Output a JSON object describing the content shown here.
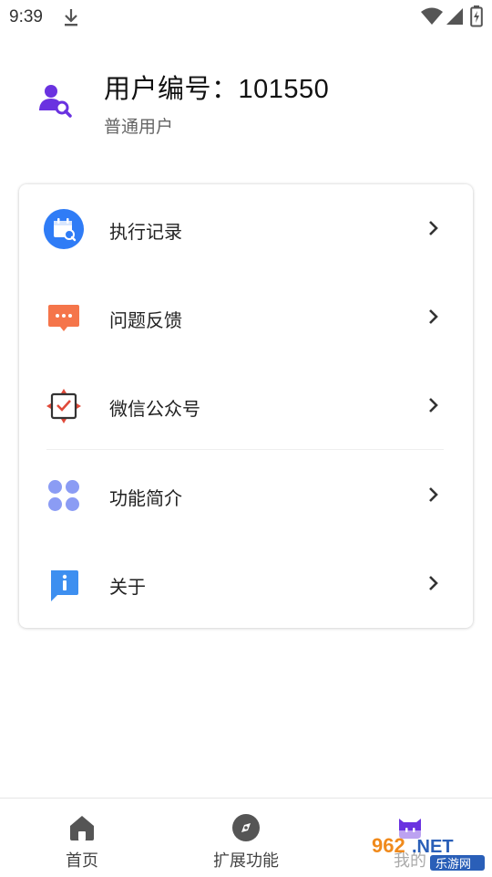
{
  "status_bar": {
    "time": "9:39",
    "icons": [
      "download-icon",
      "wifi-icon",
      "signal-icon",
      "battery-icon"
    ]
  },
  "profile": {
    "user_id": "用户编号：101550",
    "user_type": "普通用户",
    "avatar_icon": "user-search-icon"
  },
  "menu": [
    {
      "label": "执行记录",
      "icon": "calendar-search-icon"
    },
    {
      "label": "问题反馈",
      "icon": "chat-bubble-icon"
    },
    {
      "label": "微信公众号",
      "icon": "wechat-check-icon"
    },
    {
      "label": "功能简介",
      "icon": "grid-icon"
    },
    {
      "label": "关于",
      "icon": "info-icon"
    }
  ],
  "bottom_nav": [
    {
      "label": "首页",
      "icon": "home-icon"
    },
    {
      "label": "扩展功能",
      "icon": "compass-icon"
    },
    {
      "label": "我的",
      "icon": "robot-icon"
    }
  ],
  "watermark": {
    "brand": "962.NET",
    "sub": "乐游网"
  },
  "colors": {
    "accent_purple": "#6a32e0",
    "blue": "#2f7cf6",
    "orange": "#f5754a",
    "red": "#e04a3a",
    "lavender": "#8b9cf4",
    "info_blue": "#3d8ff0",
    "text_primary": "#222222",
    "text_secondary": "#666666"
  }
}
